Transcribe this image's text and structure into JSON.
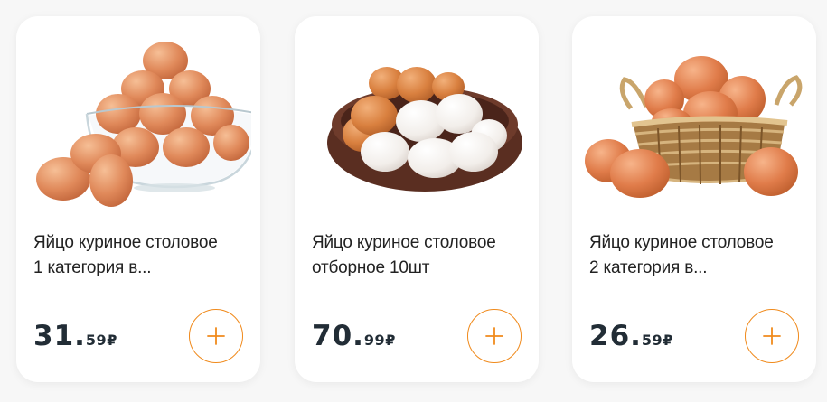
{
  "colors": {
    "accent": "#f08a1c",
    "price_text": "#222d36",
    "card_bg": "#ffffff",
    "page_bg": "#f7f7f7"
  },
  "products": [
    {
      "title_line1": "Яйцо куриное столовое",
      "title_line2": "1 категория в...",
      "price_int": "31.",
      "price_frac": "59",
      "currency": "₽",
      "image_icon": "eggs-in-glass-bowl-image",
      "add_icon": "plus-icon"
    },
    {
      "title_line1": "Яйцо куриное столовое",
      "title_line2": "отборное 10шт",
      "price_int": "70.",
      "price_frac": "99",
      "currency": "₽",
      "image_icon": "eggs-in-brown-bowl-image",
      "add_icon": "plus-icon"
    },
    {
      "title_line1": "Яйцо куриное столовое",
      "title_line2": "2 категория в...",
      "price_int": "26.",
      "price_frac": "59",
      "currency": "₽",
      "image_icon": "eggs-in-basket-image",
      "add_icon": "plus-icon"
    }
  ]
}
